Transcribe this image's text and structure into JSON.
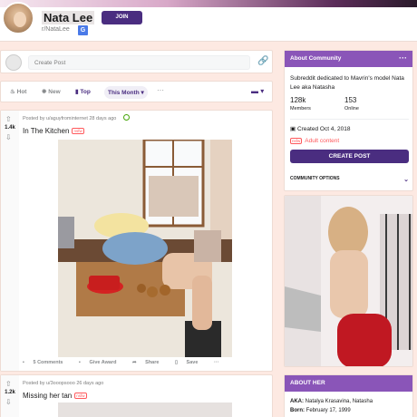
{
  "header": {
    "title": "Nata Lee",
    "subreddit": "r/NataLee",
    "lang_badge": "G",
    "join_label": "JOIN"
  },
  "create_post": {
    "placeholder": "Create Post",
    "link_icon": "link-icon"
  },
  "sort": {
    "hot": "Hot",
    "new": "New",
    "top": "Top",
    "period": "This Month ▾",
    "more": "···",
    "view": "▬ ▾"
  },
  "post1": {
    "votes": "1.4k",
    "meta": "Posted by u/aguyfrominternet 28 days ago",
    "title": "In The Kitchen",
    "nsfw": "nsfw",
    "actions": {
      "comments": "5 Comments",
      "award": "Give Award",
      "share": "Share",
      "save": "Save",
      "more": "···"
    }
  },
  "post2": {
    "votes": "1.2k",
    "meta": "Posted by u/3ooopsooo 26 days ago",
    "title": "Missing her tan",
    "nsfw": "nsfw"
  },
  "about": {
    "header": "About Community",
    "dots": "···",
    "description": "Subreddit dedicated to Mavrin's model Nata Lee aka Natasha",
    "members_count": "128k",
    "members_label": "Members",
    "online_count": "153",
    "online_label": "Online",
    "created": "Created Oct 4, 2018",
    "nsfw_tag": "nsfw",
    "adult": "Adult content",
    "create_button": "CREATE POST",
    "options": "COMMUNITY OPTIONS"
  },
  "about_her": {
    "header": "ABOUT HER",
    "aka_label": "AKA:",
    "aka_value": "Natalya Krasavina, Natasha",
    "born_label": "Born:",
    "born_value": "February 17, 1999"
  }
}
